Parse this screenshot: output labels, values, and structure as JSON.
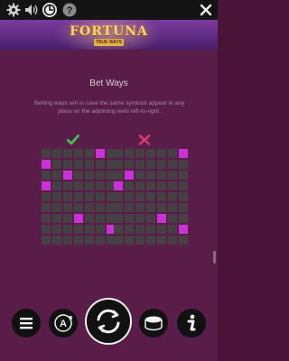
{
  "toolbar": {
    "icons": [
      "settings-icon",
      "sound-icon",
      "bet-ways-icon",
      "help-icon",
      "close-icon"
    ]
  },
  "banner": {
    "title": "FORTUNA",
    "badge": "TRUE WAYS"
  },
  "content": {
    "heading": "Bet Ways",
    "description": "Betting ways win in case the same symbols appear in any place on the adjoining reels left-to-right."
  },
  "examples": {
    "valid_marker": "check-icon",
    "invalid_marker": "cross-icon",
    "valid_highlighted": [
      [
        0,
        5
      ],
      [
        1,
        0
      ],
      [
        2,
        2
      ],
      [
        3,
        0
      ],
      [
        6,
        3
      ],
      [
        7,
        6
      ]
    ],
    "invalid_highlighted": [
      [
        0,
        6
      ],
      [
        2,
        1
      ],
      [
        3,
        0
      ],
      [
        6,
        4
      ],
      [
        7,
        6
      ]
    ]
  },
  "controls": {
    "buttons": [
      "menu-icon",
      "autoplay-icon",
      "spin-icon",
      "coin-icon",
      "info-icon"
    ]
  },
  "colors": {
    "background": "#5a1d4a",
    "highlight": "#c832d6",
    "check": "#3fc04a",
    "cross": "#d23a6a"
  }
}
